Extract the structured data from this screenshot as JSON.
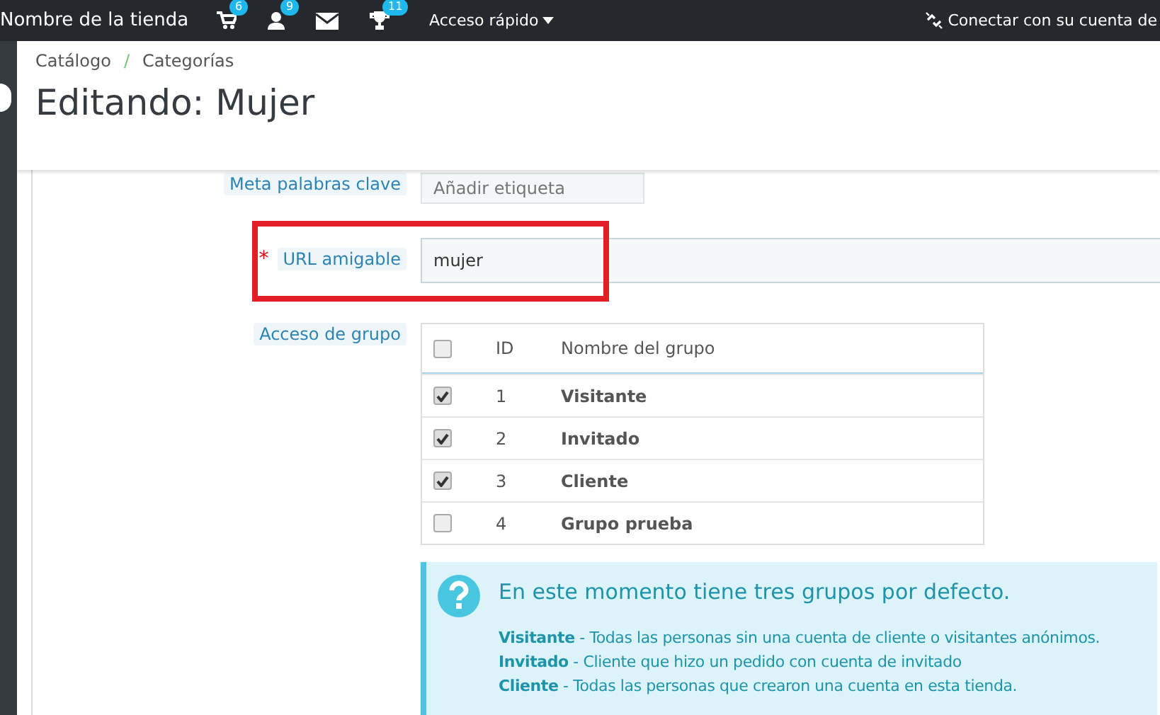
{
  "topbar": {
    "shop_name": "Nombre de la tienda",
    "icons": [
      {
        "kind": "cart",
        "badge": "6"
      },
      {
        "kind": "user",
        "badge": "9"
      },
      {
        "kind": "mail"
      },
      {
        "kind": "trophy",
        "badge": "11"
      }
    ],
    "quick_access": "Acceso rápido",
    "connect": "Conectar con su cuenta de"
  },
  "breadcrumb": [
    {
      "label": "Catálogo"
    },
    {
      "label": "Categorías"
    }
  ],
  "breadcrumb_separator": "/",
  "page_title": "Editando: Mujer",
  "form": {
    "meta_keywords": {
      "label": "Meta palabras clave",
      "placeholder": "Añadir etiqueta"
    },
    "friendly_url": {
      "label": "URL amigable",
      "required_mark": "*",
      "value": "mujer"
    },
    "group_access": {
      "label": "Acceso de grupo",
      "header_checked": false,
      "columns": [
        "ID",
        "Nombre del grupo"
      ],
      "rows": [
        {
          "checked": true,
          "id": "1",
          "name": "Visitante"
        },
        {
          "checked": true,
          "id": "2",
          "name": "Invitado"
        },
        {
          "checked": true,
          "id": "3",
          "name": "Cliente"
        },
        {
          "checked": false,
          "id": "4",
          "name": "Grupo prueba"
        }
      ]
    }
  },
  "info": {
    "title": "En este momento tiene tres grupos por defecto.",
    "lines": [
      "**Visitante** - Todas las personas sin una cuenta de cliente o visitantes anónimos.",
      "**Invitado** - Cliente que hizo un pedido con cuenta de invitado",
      "**Cliente** - Todas las personas que crearon una cuenta en esta tienda."
    ]
  }
}
